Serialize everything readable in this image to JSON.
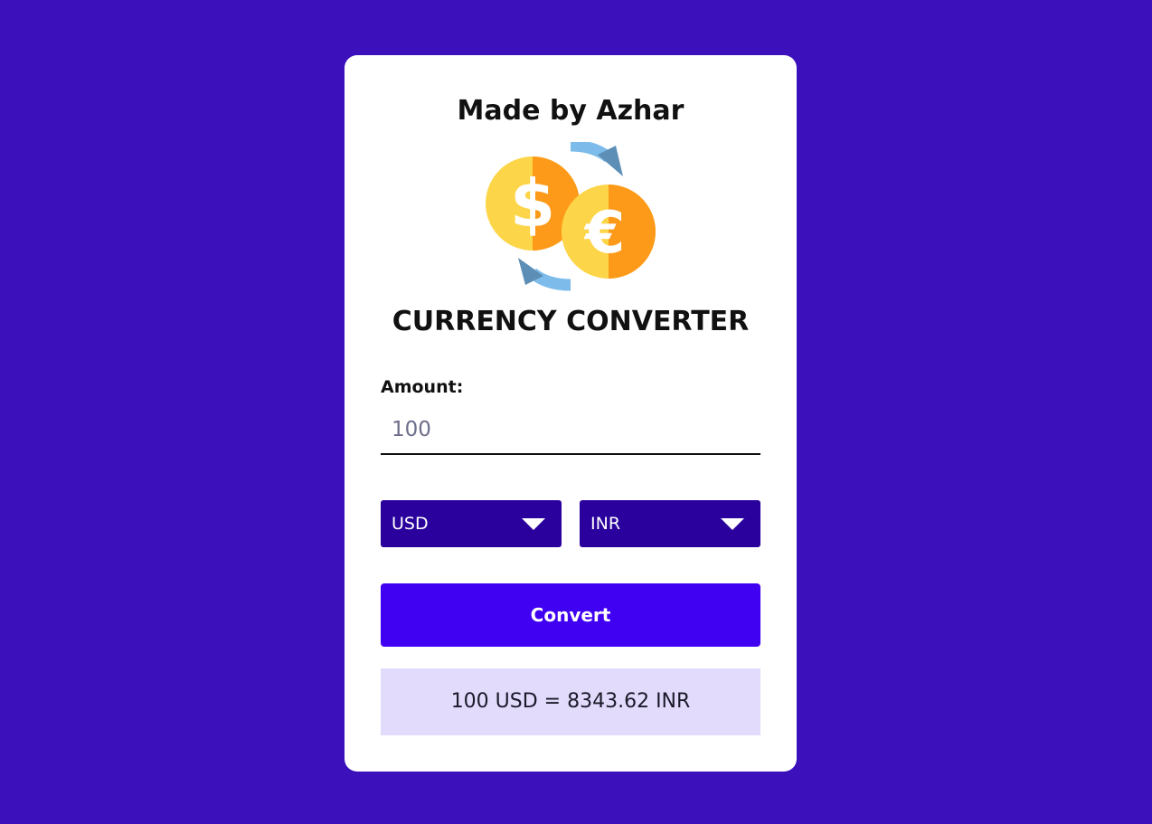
{
  "header": {
    "made_by": "Made by Azhar"
  },
  "logo": {
    "icon": "currency-exchange-icon",
    "colors": {
      "coin_light": "#fdd549",
      "coin_dark": "#fd9a1a",
      "arrow_light": "#7cbbea",
      "arrow_dark": "#5d8fb6"
    }
  },
  "title": "CURRENCY CONVERTER",
  "amount": {
    "label": "Amount:",
    "placeholder": "100",
    "value": ""
  },
  "from_currency": {
    "selected": "USD"
  },
  "to_currency": {
    "selected": "INR"
  },
  "convert_button": {
    "label": "Convert"
  },
  "result": {
    "text": "100 USD = 8343.62 INR"
  },
  "colors": {
    "background": "#3c10bb",
    "card": "#ffffff",
    "select_bg": "#2a019c",
    "button_bg": "#4000f2",
    "result_bg": "#e2dbfb"
  }
}
